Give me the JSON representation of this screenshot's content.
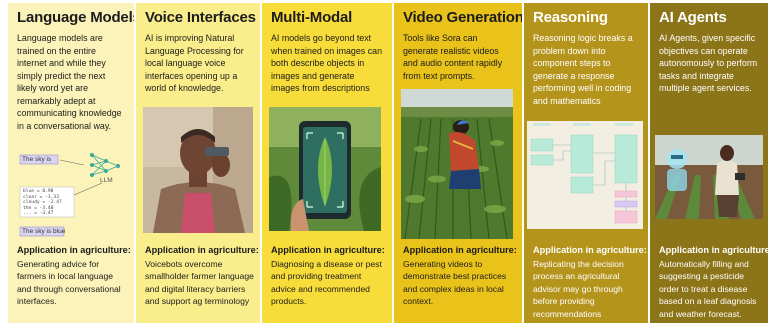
{
  "panels": [
    {
      "title": "Language Models",
      "desc": "Language models are trained on the entire internet and while they simply predict the next likely word yet are remarkably adept at communicating knowledge in a conversational way.",
      "app_heading": "Application in agriculture:",
      "app_text": "Generating advice for farmers in local language and through conversational interfaces.",
      "diagram": {
        "prompt": "The sky is",
        "output": "The sky is blue",
        "model_label": "LLM",
        "scores": [
          "blue = 0.98",
          "clear = -1.33",
          "cloudy = -2.47",
          "the = -3.40",
          "... = -3.47"
        ]
      }
    },
    {
      "title": "Voice Interfaces",
      "desc": "AI is improving Natural Language Processing for local language voice interfaces opening up a world of knowledge.",
      "app_heading": "Application in agriculture:",
      "app_text": "Voicebots overcome smallholder farmer language and digital literacy barriers and support ag terminology"
    },
    {
      "title": "Multi-Modal",
      "desc": "AI models go beyond text when trained on images can both describe objects in images and generate images from descriptions",
      "app_heading": "Application in agriculture:",
      "app_text": "Diagnosing a disease or pest and providing treatment advice and recommended products."
    },
    {
      "title": "Video Generation",
      "desc": "Tools like Sora can generate realistic videos and audio content rapidly from text prompts.",
      "app_heading": "Application in agriculture:",
      "app_text": "Generating videos to demonstrate best practices and complex ideas in local context."
    },
    {
      "title": "Reasoning",
      "desc": "Reasoning logic breaks a problem down into component steps to generate a response performing well in coding and mathematics",
      "app_heading": "Application in agriculture:",
      "app_text": "Replicating the decision process an agricultural advisor may go through before providing recommendations"
    },
    {
      "title": "AI Agents",
      "desc": "AI Agents, given specific objectives can operate autonomously to perform tasks and integrate multiple agent services.",
      "app_heading": "Application in agriculture:",
      "app_text": "Automatically filling and suggesting a pesticide order to treat a disease based on a leaf diagnosis and weather forecast."
    }
  ],
  "colors": {
    "panel1": "#fbf3b9",
    "panel2": "#faed8c",
    "panel3": "#f7dc3a",
    "panel4": "#e9c21a",
    "panel5": "#b5941c",
    "panel6": "#8c7418"
  }
}
